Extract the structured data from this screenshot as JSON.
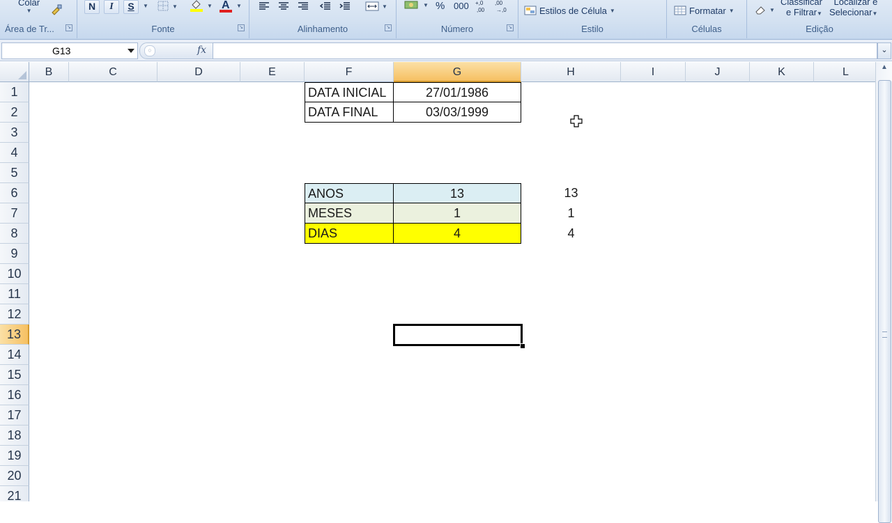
{
  "ribbon": {
    "groups": [
      {
        "id": "clipboard",
        "label": "Área de Tr...",
        "items": [
          {
            "label": "Colar"
          }
        ]
      },
      {
        "id": "font",
        "label": "Fonte",
        "items": [
          {
            "label": "N"
          },
          {
            "label": "I"
          },
          {
            "label": "S"
          }
        ]
      },
      {
        "id": "alignment",
        "label": "Alinhamento"
      },
      {
        "id": "number",
        "label": "Número",
        "items": [
          {
            "label": "%"
          },
          {
            "label": "000"
          }
        ]
      },
      {
        "id": "style",
        "label": "Estilo",
        "items": [
          {
            "label": "Estilos de Célula"
          }
        ]
      },
      {
        "id": "cells",
        "label": "Células",
        "items": [
          {
            "label": "Formatar"
          }
        ]
      },
      {
        "id": "editing",
        "label": "Edição",
        "items": [
          {
            "label": "Classificar"
          },
          {
            "label": "e Filtrar"
          },
          {
            "label": "Localizar e"
          },
          {
            "label": "Selecionar"
          }
        ]
      }
    ]
  },
  "formula_bar": {
    "name_box": "G13",
    "fx": "fx",
    "content": ""
  },
  "grid": {
    "columns": [
      "B",
      "C",
      "D",
      "E",
      "F",
      "G",
      "H",
      "I",
      "J",
      "K",
      "L"
    ],
    "selected_column": "G",
    "rows": [
      "1",
      "2",
      "3",
      "4",
      "5",
      "6",
      "7",
      "8",
      "9",
      "10",
      "11",
      "12",
      "13",
      "14",
      "15",
      "16",
      "17",
      "18",
      "19",
      "20",
      "21"
    ],
    "selected_row": "13",
    "cells": {
      "F1": "DATA INICIAL",
      "G1": "27/01/1986",
      "F2": "DATA FINAL",
      "G2": "03/03/1999",
      "F6": "ANOS",
      "G6": "13",
      "H6": "13",
      "F7": "MESES",
      "G7": "1",
      "H7": "1",
      "F8": "DIAS",
      "G8": "4",
      "H8": "4"
    },
    "active_cell": "G13",
    "fills": {
      "row6": "#dbeef3",
      "row7": "#ebf1de",
      "row8": "#ffff00"
    }
  }
}
